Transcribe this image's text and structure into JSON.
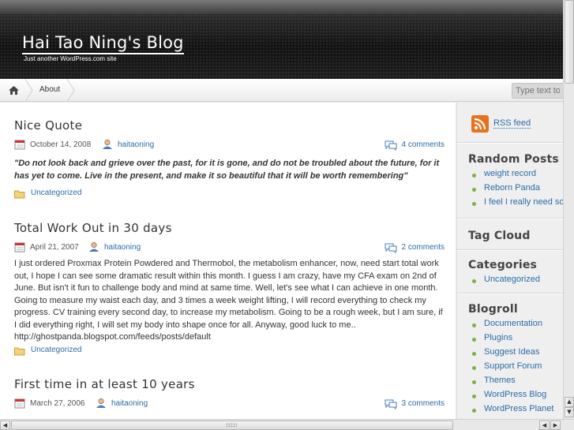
{
  "header": {
    "blog_title": "Hai Tao Ning's Blog",
    "tagline": "Just another WordPress.com site"
  },
  "nav": {
    "home_icon": "home-icon",
    "about_label": "About",
    "search_placeholder": "Type text to"
  },
  "posts": [
    {
      "title": "Nice Quote",
      "date": "October 14, 2008",
      "author": "haitaoning",
      "comments": "4 comments",
      "body": "\"Do not look back and grieve over the past, for it is gone, and do not be troubled about the future, for it has yet to come. Live in the present, and make it so beautiful that it will be worth remembering\"",
      "category": "Uncategorized"
    },
    {
      "title": "Total Work Out in 30 days",
      "date": "April 21, 2007",
      "author": "haitaoning",
      "comments": "2 comments",
      "body": "I just ordered Proxmax Protein Powdered and Thermobol, the metabolism enhancer, now, need start total work out, I hope I can see some dramatic result within this month. I guess I am crazy, have my CFA exam on 2nd of June. But isn't it fun to challenge body and mind at same time. Well, let's see what I can achieve in one month. Going to measure my waist each day, and 3 times a week weight lifting, I will record everything to check my progress. CV training every second day, to increase my metabolism. Going to be a rough week, but I am sure, if I did everything right, I will set my body into shape once for all. Anyway, good luck to me.. http://ghostpanda.blogspot.com/feeds/posts/default",
      "category": "Uncategorized"
    },
    {
      "title": "First time in at least 10 years",
      "date": "March 27, 2006",
      "author": "haitaoning",
      "comments": "3 comments"
    }
  ],
  "sidebar": {
    "rss_label": "RSS feed",
    "random_posts": {
      "title": "Random Posts",
      "items": [
        "weight record",
        "Reborn Panda",
        "I feel I really need so"
      ]
    },
    "tag_cloud": {
      "title": "Tag Cloud"
    },
    "categories": {
      "title": "Categories",
      "items": [
        "Uncategorized"
      ]
    },
    "blogroll": {
      "title": "Blogroll",
      "items": [
        "Documentation",
        "Plugins",
        "Suggest Ideas",
        "Support Forum",
        "Themes",
        "WordPress Blog",
        "WordPress Planet"
      ]
    }
  },
  "colors": {
    "link": "#2b6ca8",
    "bullet": "#7bb04a",
    "header_bg": "#111111"
  }
}
